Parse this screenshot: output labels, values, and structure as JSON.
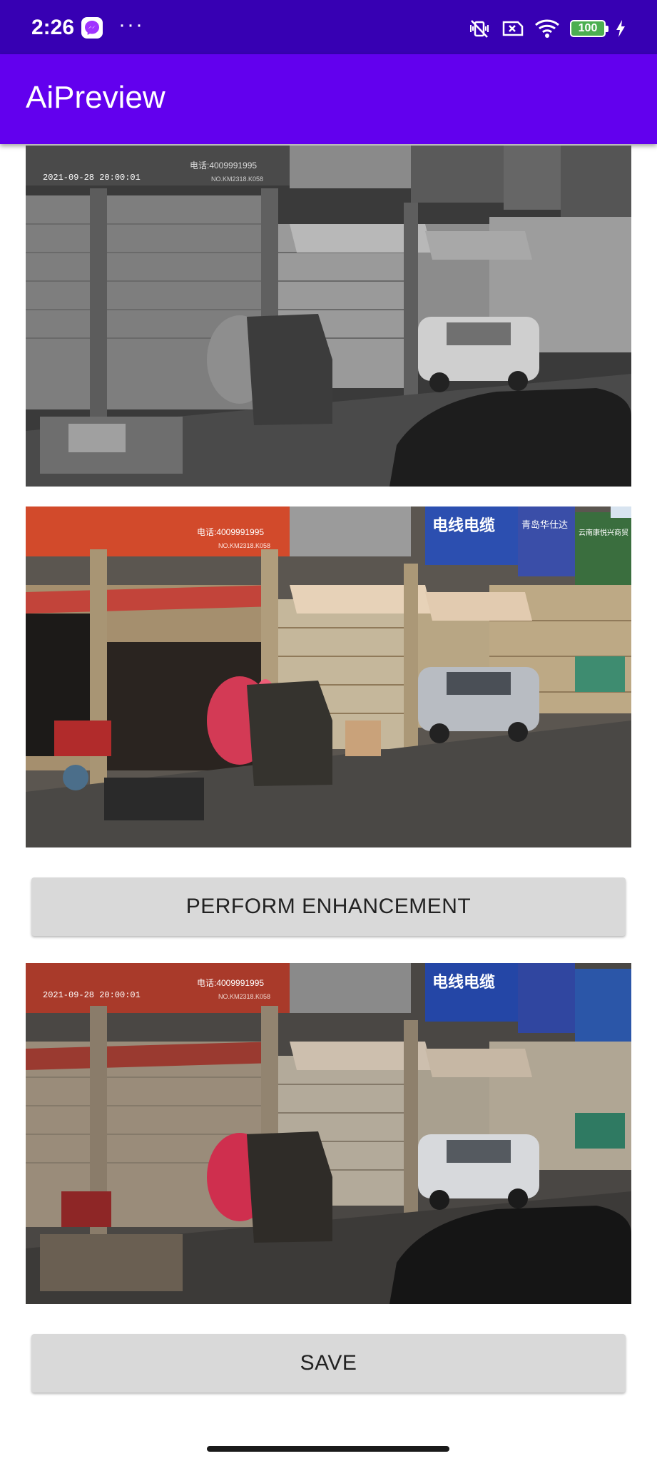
{
  "status_bar": {
    "time": "2:26",
    "more": "···",
    "battery": "100",
    "icons": [
      "messenger-icon",
      "vibrate-off-icon",
      "sim-off-icon",
      "wifi-icon",
      "battery-icon",
      "charging-icon"
    ]
  },
  "app_bar": {
    "title": "AiPreview"
  },
  "images": {
    "original": {
      "kind": "grayscale night camera frame"
    },
    "reference": {
      "kind": "color daytime camera frame"
    },
    "enhanced": {
      "kind": "enhanced color camera frame"
    }
  },
  "overlay": {
    "timestamp": "2021-09-28 20:00:01",
    "sign_phone": "电话:4009991995",
    "sign_code": "NO.KM2318.K058",
    "sign_cable": "电线电缆",
    "sign_qingdao": "青岛华仕达",
    "sign_yunnan": "云南康悦兴商贸"
  },
  "buttons": {
    "enhance_label": "PERFORM ENHANCEMENT",
    "save_label": "SAVE"
  },
  "colors": {
    "status_bar": "#3700B3",
    "app_bar": "#6200EE",
    "button": "#d9d9d9"
  }
}
